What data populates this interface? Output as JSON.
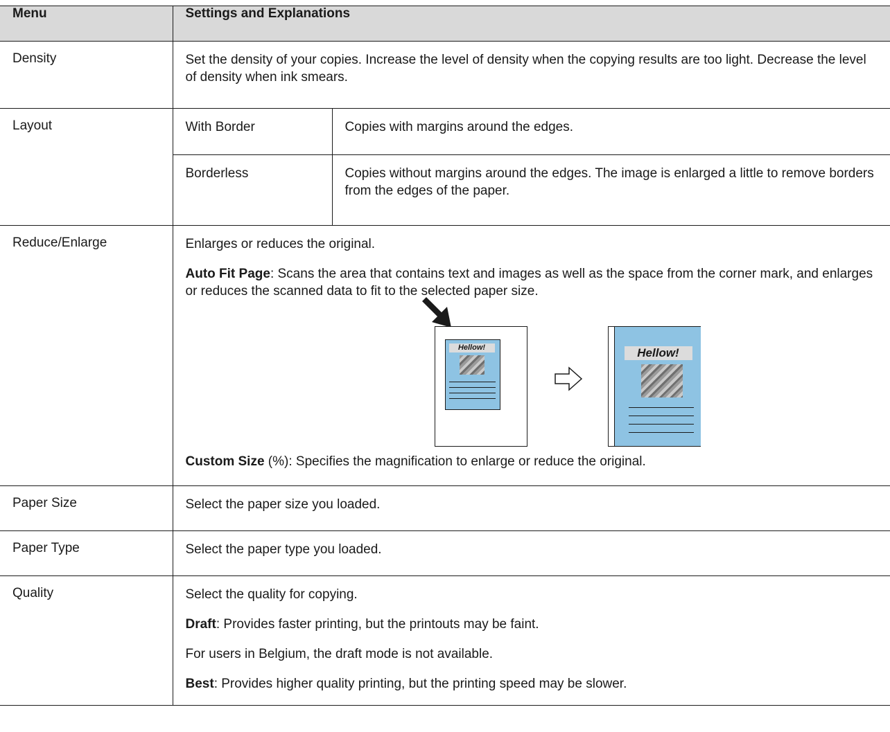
{
  "header": {
    "col1": "Menu",
    "col2": "Settings and Explanations"
  },
  "density": {
    "menu": "Density",
    "text": "Set the density of your copies. Increase the level of density when the copying results are too light. Decrease the level of density when ink smears."
  },
  "layout": {
    "menu": "Layout",
    "options": [
      {
        "name": "With Border",
        "desc": "Copies with margins around the edges."
      },
      {
        "name": "Borderless",
        "desc": "Copies without margins around the edges. The image is enlarged a little to remove borders from the edges of the paper."
      }
    ]
  },
  "reduce": {
    "menu": "Reduce/Enlarge",
    "intro": "Enlarges or reduces the original.",
    "auto_fit_label": "Auto Fit Page",
    "auto_fit_text": ": Scans the area that contains text and images as well as the space from the corner mark, and enlarges or reduces the scanned data to fit to the selected paper size.",
    "figure_text_small": "Hellow!",
    "figure_text_large": "Hellow!",
    "custom_label": "Custom Size",
    "custom_text": " (%): Specifies the magnification to enlarge or reduce the original."
  },
  "paper_size": {
    "menu": "Paper Size",
    "text": "Select the paper size you loaded."
  },
  "paper_type": {
    "menu": "Paper Type",
    "text": "Select the paper type you loaded."
  },
  "quality": {
    "menu": "Quality",
    "intro": "Select the quality for copying.",
    "draft_label": "Draft",
    "draft_text": ": Provides faster printing, but the printouts may be faint.",
    "belgium_note": "For users in Belgium, the draft mode is not available.",
    "best_label": "Best",
    "best_text": ": Provides higher quality printing, but the printing speed may be slower."
  },
  "colors": {
    "header_bg": "#d9d9d9",
    "doc_blue": "#8ec3e3"
  }
}
